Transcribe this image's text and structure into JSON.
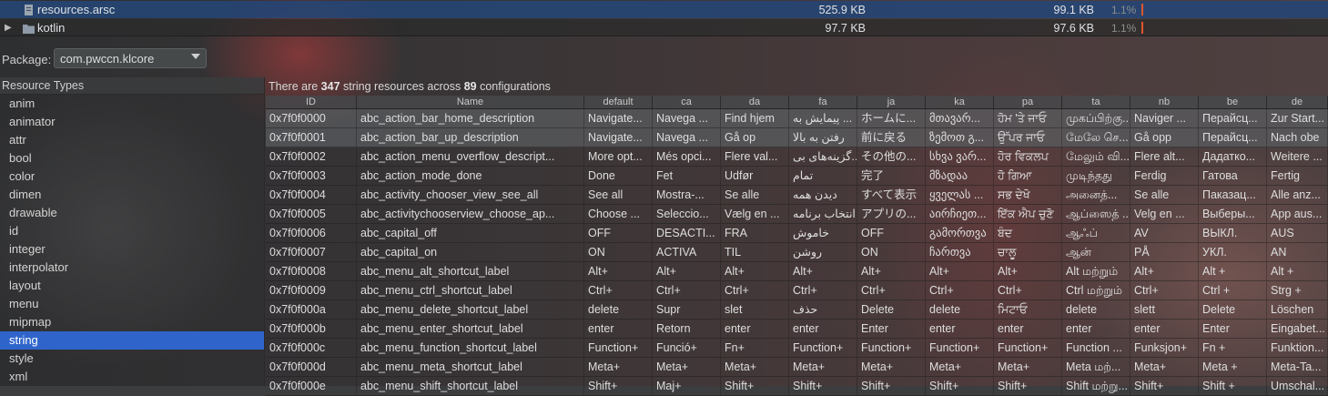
{
  "files": [
    {
      "name": "resources.arsc",
      "raw": "525.9 KB",
      "download": "99.1 KB",
      "percent": "1.1%",
      "expandable": false,
      "selected": true,
      "icon": "file-icon"
    },
    {
      "name": "kotlin",
      "raw": "97.7 KB",
      "download": "97.6 KB",
      "percent": "1.1%",
      "expandable": true,
      "selected": false,
      "icon": "folder-icon"
    }
  ],
  "package": {
    "label": "Package:",
    "value": "com.pwccn.klcore"
  },
  "resource_types": {
    "header": "Resource Types",
    "items": [
      "anim",
      "animator",
      "attr",
      "bool",
      "color",
      "dimen",
      "drawable",
      "id",
      "integer",
      "interpolator",
      "layout",
      "menu",
      "mipmap",
      "string",
      "style",
      "xml"
    ],
    "selected": "string"
  },
  "info": {
    "prefix": "There are ",
    "count": "347",
    "middle": " string resources across ",
    "configs": "89",
    "suffix": " configurations"
  },
  "table": {
    "columns": [
      "ID",
      "Name",
      "default",
      "ca",
      "da",
      "fa",
      "ja",
      "ka",
      "pa",
      "ta",
      "nb",
      "be",
      "de"
    ],
    "rows": [
      [
        "0x7f0f0000",
        "abc_action_bar_home_description",
        "Navigate...",
        "Navega ...",
        "Find hjem",
        "پیمایش به ...",
        "ホームに...",
        "მთავარ...",
        "ਹੋਮ 'ਤੇ ਜਾਓ",
        "முகப்பிற்கு...",
        "Naviger ...",
        "Перайсц...",
        "Zur Start..."
      ],
      [
        "0x7f0f0001",
        "abc_action_bar_up_description",
        "Navigate...",
        "Navega ...",
        "Gå op",
        "رفتن به بالا",
        "前に戻る",
        "ზემოთ გ...",
        "ਉੱਪਰ ਜਾਓ",
        "மேலே செ...",
        "Gå opp",
        "Перайсц...",
        "Nach obe"
      ],
      [
        "0x7f0f0002",
        "abc_action_menu_overflow_descript...",
        "More opt...",
        "Més opci...",
        "Flere val...",
        "گزینه‌های بی...",
        "その他の...",
        "სხვა ვარ...",
        "ਹੋਰ ਵਿਕਲਪ",
        "மேலும் வி...",
        "Flere alt...",
        "Дадатко...",
        "Weitere ..."
      ],
      [
        "0x7f0f0003",
        "abc_action_mode_done",
        "Done",
        "Fet",
        "Udfør",
        "تمام",
        "完了",
        "მზადაა",
        "ਹੋ ਗਿਆ",
        "முடிந்தது",
        "Ferdig",
        "Гатова",
        "Fertig"
      ],
      [
        "0x7f0f0004",
        "abc_activity_chooser_view_see_all",
        "See all",
        "Mostra-...",
        "Se alle",
        "دیدن همه",
        "すべて表示",
        "ყველას ...",
        "ਸਭ ਦੇਖੋ",
        "அனைத்...",
        "Se alle",
        "Паказац...",
        "Alle anz..."
      ],
      [
        "0x7f0f0005",
        "abc_activitychooserview_choose_ap...",
        "Choose ...",
        "Seleccio...",
        "Vælg en ...",
        "انتخاب برنامه",
        "アプリの...",
        "აირჩიეთ...",
        "ਇੱਕ ਐਪ ਚੁਣੋ",
        "ஆப்ஸைத் ...",
        "Velg en ...",
        "Выберы...",
        "App aus..."
      ],
      [
        "0x7f0f0006",
        "abc_capital_off",
        "OFF",
        "DESACTI...",
        "FRA",
        "خاموش",
        "OFF",
        "გამორთვა",
        "ਬੰਦ",
        "ஆஃப்",
        "AV",
        "ВЫКЛ.",
        "AUS"
      ],
      [
        "0x7f0f0007",
        "abc_capital_on",
        "ON",
        "ACTIVA",
        "TIL",
        "روشن",
        "ON",
        "ჩართვა",
        "ਚਾਲੂ",
        "ஆன்",
        "PÅ",
        "УКЛ.",
        "AN"
      ],
      [
        "0x7f0f0008",
        "abc_menu_alt_shortcut_label",
        "Alt+",
        "Alt+",
        "Alt+",
        "Alt+",
        "Alt+",
        "Alt+",
        "Alt+",
        "Alt மற்றும்",
        "Alt+",
        "Alt +",
        "Alt +"
      ],
      [
        "0x7f0f0009",
        "abc_menu_ctrl_shortcut_label",
        "Ctrl+",
        "Ctrl+",
        "Ctrl+",
        "Ctrl+",
        "Ctrl+",
        "Ctrl+",
        "Ctrl+",
        "Ctrl மற்றும்",
        "Ctrl+",
        "Ctrl +",
        "Strg +"
      ],
      [
        "0x7f0f000a",
        "abc_menu_delete_shortcut_label",
        "delete",
        "Supr",
        "slet",
        "حذف",
        "Delete",
        "delete",
        "ਮਿਟਾਓ",
        "delete",
        "slett",
        "Delete",
        "Löschen"
      ],
      [
        "0x7f0f000b",
        "abc_menu_enter_shortcut_label",
        "enter",
        "Retorn",
        "enter",
        "enter",
        "Enter",
        "enter",
        "enter",
        "enter",
        "enter",
        "Enter",
        "Eingabet..."
      ],
      [
        "0x7f0f000c",
        "abc_menu_function_shortcut_label",
        "Function+",
        "Funció+",
        "Fn+",
        "Function+",
        "Function+",
        "Function+",
        "Function+",
        "Function ...",
        "Funksjon+",
        "Fn +",
        "Funktion..."
      ],
      [
        "0x7f0f000d",
        "abc_menu_meta_shortcut_label",
        "Meta+",
        "Meta+",
        "Meta+",
        "Meta+",
        "Meta+",
        "Meta+",
        "Meta+",
        "Meta மற்...",
        "Meta+",
        "Meta +",
        "Meta-Ta..."
      ],
      [
        "0x7f0f000e",
        "abc_menu_shift_shortcut_label",
        "Shift+",
        "Maj+",
        "Shift+",
        "Shift+",
        "Shift+",
        "Shift+",
        "Shift+",
        "Shift மற்று...",
        "Shift+",
        "Shift +",
        "Umschal..."
      ]
    ]
  },
  "colors": {
    "accent": "#2f65ca",
    "size_bar": "#e0562b",
    "selected_file_row": "#23467a"
  }
}
